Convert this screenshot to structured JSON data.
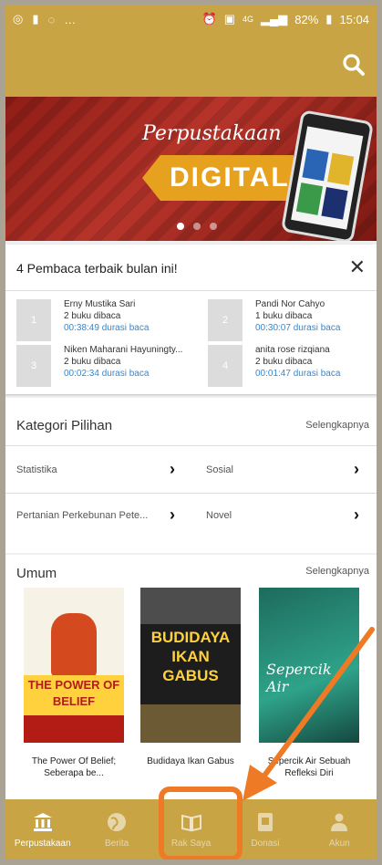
{
  "status_bar": {
    "battery": "82%",
    "time": "15:04",
    "network": "4G"
  },
  "banner": {
    "script_text": "Perpustakaan",
    "main_text": "DIGITAL"
  },
  "readers": {
    "title": "4 Pembaca terbaik bulan ini!",
    "items": [
      {
        "rank": "1",
        "name": "Erny Mustika Sari",
        "books": "2 buku dibaca",
        "duration": "00:38:49 durasi baca"
      },
      {
        "rank": "2",
        "name": "Pandi Nor Cahyo",
        "books": "1 buku dibaca",
        "duration": "00:30:07 durasi baca"
      },
      {
        "rank": "3",
        "name": "Niken Maharani Hayuningty...",
        "books": "2 buku dibaca",
        "duration": "00:02:34 durasi baca"
      },
      {
        "rank": "4",
        "name": "anita rose rizqiana",
        "books": "2 buku dibaca",
        "duration": "00:01:47 durasi baca"
      }
    ]
  },
  "kategori": {
    "title": "Kategori Pilihan",
    "more": "Selengkapnya",
    "items": [
      "Statistika",
      "Sosial",
      "Pertanian Perkebunan Pete...",
      "Novel"
    ]
  },
  "umum": {
    "title": "Umum",
    "more": "Selengkapnya",
    "books": [
      {
        "title": "The Power Of Belief; Seberapa be...",
        "cover_text": "THE POWER OF BELIEF"
      },
      {
        "title": "Budidaya Ikan Gabus",
        "cover_text": "BUDIDAYA IKAN GABUS"
      },
      {
        "title": "Sepercik Air Sebuah Refleksi Diri",
        "cover_text": "Sepercik Air"
      }
    ]
  },
  "nav": {
    "items": [
      {
        "label": "Perpustakaan",
        "icon": "library-icon"
      },
      {
        "label": "Berita",
        "icon": "globe-icon"
      },
      {
        "label": "Rak Saya",
        "icon": "book-icon"
      },
      {
        "label": "Donasi",
        "icon": "donation-icon"
      },
      {
        "label": "Akun",
        "icon": "person-icon"
      }
    ]
  },
  "colors": {
    "primary": "#c9a444",
    "highlight": "#ee7a26",
    "link": "#3a86c8"
  }
}
